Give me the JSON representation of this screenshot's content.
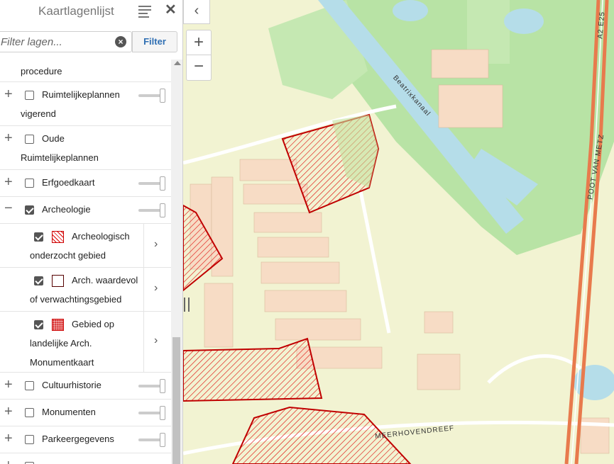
{
  "panel": {
    "title": "Kaartlagenlijst",
    "close_label": "✕",
    "filter_placeholder": "Filter lagen...",
    "filter_button": "Filter",
    "clear_label": "×"
  },
  "layers": [
    {
      "label": "procedure",
      "checked": false
    },
    {
      "label": "Ruimtelijkeplannen vigerend",
      "checked": false
    },
    {
      "label": "Oude Ruimtelijkeplannen",
      "checked": false
    },
    {
      "label": "Erfgoedkaart",
      "checked": false
    },
    {
      "label": "Archeologie",
      "checked": true,
      "expanded": true,
      "sublayers": [
        {
          "label": "Archeologisch onderzocht gebied",
          "checked": true
        },
        {
          "label": "Arch. waardevol of verwachtingsgebied",
          "checked": true
        },
        {
          "label": "Gebied op landelijke Arch. Monumentkaart",
          "checked": true
        }
      ]
    },
    {
      "label": "Cultuurhistorie",
      "checked": false
    },
    {
      "label": "Monumenten",
      "checked": false
    },
    {
      "label": "Parkeergegevens",
      "checked": false
    }
  ],
  "map": {
    "labels": {
      "canal": "Beatrixkanaal",
      "street1": "POOT VAN METZ",
      "highway": "A2 E25",
      "street2": "MEERHOVENDREEF"
    },
    "controls": {
      "collapse": "‹",
      "zoom_in": "+",
      "zoom_out": "−"
    }
  },
  "colors": {
    "archeo_red": "#c00000",
    "map_green": "#b6e0a3",
    "map_built": "#f7dcc5",
    "water": "#b5dde9",
    "highway": "#e87a4d"
  }
}
